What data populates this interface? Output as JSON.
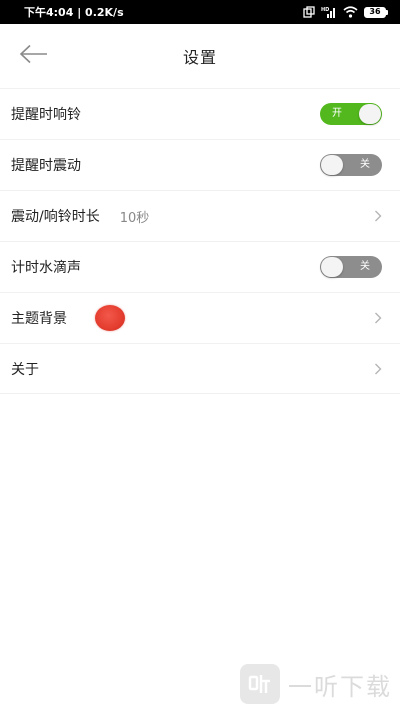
{
  "status_bar": {
    "time_speed": "下午4:04 | 0.2K/s",
    "network_label": "HD",
    "battery_level": "36"
  },
  "header": {
    "title": "设置"
  },
  "settings": {
    "reminder_ring": {
      "label": "提醒时响铃",
      "toggle_text": "开",
      "state": "on"
    },
    "reminder_vibrate": {
      "label": "提醒时震动",
      "toggle_text": "关",
      "state": "off"
    },
    "vibrate_duration": {
      "label": "震动/响铃时长",
      "value": "10秒"
    },
    "timer_water_sound": {
      "label": "计时水滴声",
      "toggle_text": "关",
      "state": "off"
    },
    "theme_background": {
      "label": "主题背景",
      "swatch_color": "#e43d2f"
    },
    "about": {
      "label": "关于"
    }
  },
  "colors": {
    "toggle_on": "#52b81d",
    "toggle_off": "#8d8d8d"
  },
  "watermark": {
    "text": "一听下载"
  }
}
